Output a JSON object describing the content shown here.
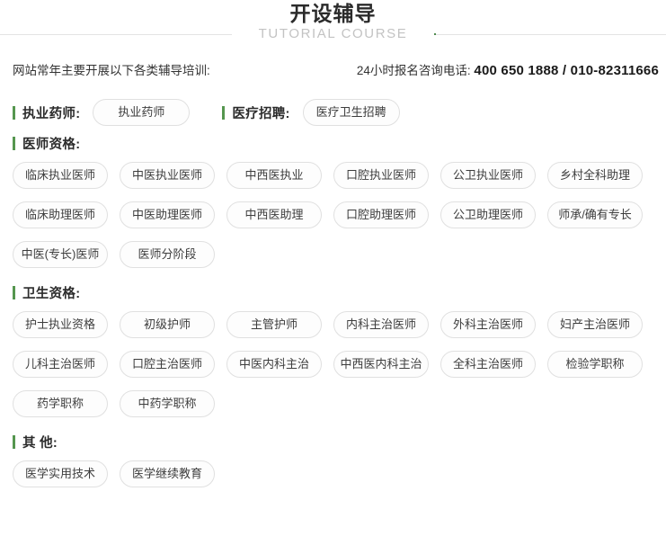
{
  "header": {
    "title": "开设辅导",
    "subtitle": "TUTORIAL COURSE",
    "accent_color": "#4f8a4f",
    "rule_color": "#e3e3e3"
  },
  "info": {
    "left_text": "网站常年主要开展以下各类辅导培训:",
    "right_label": "24小时报名咨询电话:",
    "phone": "400 650 1888 / 010-82311666"
  },
  "inline_sections": [
    {
      "label": "执业药师:",
      "button": "执业药师"
    },
    {
      "label": "医疗招聘:",
      "button": "医疗卫生招聘"
    }
  ],
  "sections": [
    {
      "label": "医师资格:",
      "items": [
        "临床执业医师",
        "中医执业医师",
        "中西医执业",
        "口腔执业医师",
        "公卫执业医师",
        "乡村全科助理",
        "临床助理医师",
        "中医助理医师",
        "中西医助理",
        "口腔助理医师",
        "公卫助理医师",
        "师承/确有专长",
        "中医(专长)医师",
        "医师分阶段"
      ]
    },
    {
      "label": "卫生资格:",
      "items": [
        "护士执业资格",
        "初级护师",
        "主管护师",
        "内科主治医师",
        "外科主治医师",
        "妇产主治医师",
        "儿科主治医师",
        "口腔主治医师",
        "中医内科主治",
        "中西医内科主治",
        "全科主治医师",
        "检验学职称",
        "药学职称",
        "中药学职称"
      ]
    },
    {
      "label": "其 他:",
      "items": [
        "医学实用技术",
        "医学继续教育"
      ]
    }
  ]
}
